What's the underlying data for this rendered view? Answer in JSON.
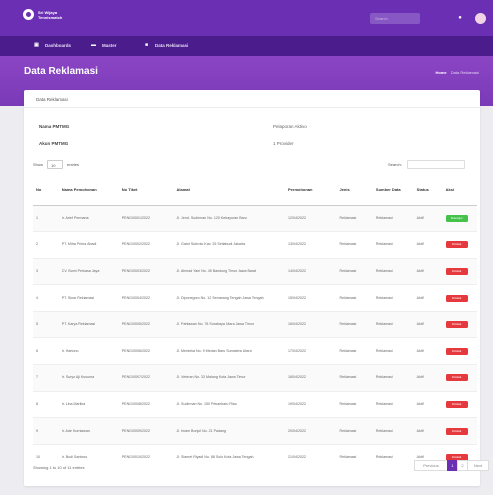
{
  "app": {
    "brand": "Sri Wijaya Tennismatch",
    "search_placeholder": "Search"
  },
  "nav": {
    "items": [
      {
        "label": "Dashboards",
        "icon": "dashboard-icon"
      },
      {
        "label": "Master",
        "icon": "database-icon"
      },
      {
        "label": "Data Reklamasi",
        "icon": "user-icon"
      }
    ]
  },
  "header": {
    "title": "Data Reklamasi",
    "breadcrumb_home": "Home",
    "breadcrumb_current": "Data Reklamasi"
  },
  "card": {
    "title": "Data Reklamasi",
    "info": [
      {
        "label": "Nama PMTMG",
        "value": "Pelaporan Aktivo"
      },
      {
        "label": "Akun PMTMG",
        "value": "1 Provider"
      }
    ]
  },
  "table_controls": {
    "show_label": "Show",
    "show_value": "10",
    "entries_label": "entries",
    "search_label": "Search:"
  },
  "table": {
    "columns": [
      "No",
      "Nama Pemohonan",
      "No Tiket",
      "Alamat",
      "Permohonan",
      "Jenis",
      "Sumber Data",
      "Status",
      "Aksi"
    ],
    "rows": [
      {
        "no": "1",
        "nama": "Ir. Arief Permana",
        "tiket": "PENG/0001/2022",
        "alamat": "Jl. Jend. Sudirman No. 120 Kebayoran Baru",
        "permohonan": "12/04/2022",
        "jenis": "Reklamasi",
        "sumber": "Reklamasi",
        "status": "Aktif",
        "aksi": "Disetujui",
        "color": "#45c24a"
      },
      {
        "no": "2",
        "nama": "PT. Mitra Prima Abadi",
        "tiket": "PENG/0002/2022",
        "alamat": "Jl. Gatot Subroto Kav. 25 Setiabudi Jakarta",
        "permohonan": "13/04/2022",
        "jenis": "Reklamasi",
        "sumber": "Reklamasi",
        "status": "Aktif",
        "aksi": "Ditolak",
        "color": "#e5393e"
      },
      {
        "no": "3",
        "nama": "CV. Bumi Perkasa Jaya",
        "tiket": "PENG/0003/2022",
        "alamat": "Jl. Ahmad Yani No. 45 Bandung Timur Jawa Barat",
        "permohonan": "14/04/2022",
        "jenis": "Reklamasi",
        "sumber": "Reklamasi",
        "status": "Aktif",
        "aksi": "Ditolak",
        "color": "#e5393e"
      },
      {
        "no": "4",
        "nama": "PT. Sinar Reklamasi",
        "tiket": "PENG/0004/2022",
        "alamat": "Jl. Diponegoro No. 12 Semarang Tengah Jawa Tengah",
        "permohonan": "15/04/2022",
        "jenis": "Reklamasi",
        "sumber": "Reklamasi",
        "status": "Aktif",
        "aksi": "Ditolak",
        "color": "#e5393e"
      },
      {
        "no": "5",
        "nama": "PT. Karya Reklamasi",
        "tiket": "PENG/0005/2022",
        "alamat": "Jl. Pahlawan No. 78 Surabaya Utara Jawa Timur",
        "permohonan": "16/04/2022",
        "jenis": "Reklamasi",
        "sumber": "Reklamasi",
        "status": "Aktif",
        "aksi": "Ditolak",
        "color": "#e5393e"
      },
      {
        "no": "6",
        "nama": "Ir. Hartono",
        "tiket": "PENG/0006/2022",
        "alamat": "Jl. Merdeka No. 9 Medan Baru Sumatera Utara",
        "permohonan": "17/04/2022",
        "jenis": "Reklamasi",
        "sumber": "Reklamasi",
        "status": "Aktif",
        "aksi": "Ditolak",
        "color": "#e5393e"
      },
      {
        "no": "7",
        "nama": "Ir. Suryo Aji Kusuma",
        "tiket": "PENG/0007/2022",
        "alamat": "Jl. Veteran No. 33 Malang Kota Jawa Timur",
        "permohonan": "18/04/2022",
        "jenis": "Reklamasi",
        "sumber": "Reklamasi",
        "status": "Aktif",
        "aksi": "Ditolak",
        "color": "#e5393e"
      },
      {
        "no": "8",
        "nama": "Ir. Lina Marlina",
        "tiket": "PENG/0008/2022",
        "alamat": "Jl. Sudirman No. 150 Pekanbaru Riau",
        "permohonan": "19/04/2022",
        "jenis": "Reklamasi",
        "sumber": "Reklamasi",
        "status": "Aktif",
        "aksi": "Ditolak",
        "color": "#e5393e"
      },
      {
        "no": "9",
        "nama": "Ir. Ade Kurniawan",
        "tiket": "PENG/0009/2022",
        "alamat": "Jl. Imam Bonjol No. 21 Padang",
        "permohonan": "20/04/2022",
        "jenis": "Reklamasi",
        "sumber": "Reklamasi",
        "status": "Aktif",
        "aksi": "Ditolak",
        "color": "#e5393e"
      },
      {
        "no": "10",
        "nama": "Ir. Budi Santoso",
        "tiket": "PENG/0010/2022",
        "alamat": "Jl. Slamet Riyadi No. 88 Solo Kota Jawa Tengah",
        "permohonan": "21/04/2022",
        "jenis": "Reklamasi",
        "sumber": "Reklamasi",
        "status": "Aktif",
        "aksi": "Ditolak",
        "color": "#e5393e"
      }
    ]
  },
  "footer": {
    "info": "Showing 1 to 10 of 11 entries",
    "pagination": {
      "previous": "Previous",
      "page1": "1",
      "page2": "2",
      "next": "Next"
    }
  },
  "colors": {
    "topbar": "#6a2fb2",
    "navbar": "#4a1c8c",
    "header": "#8b45c4",
    "success": "#45c24a",
    "danger": "#e5393e"
  }
}
